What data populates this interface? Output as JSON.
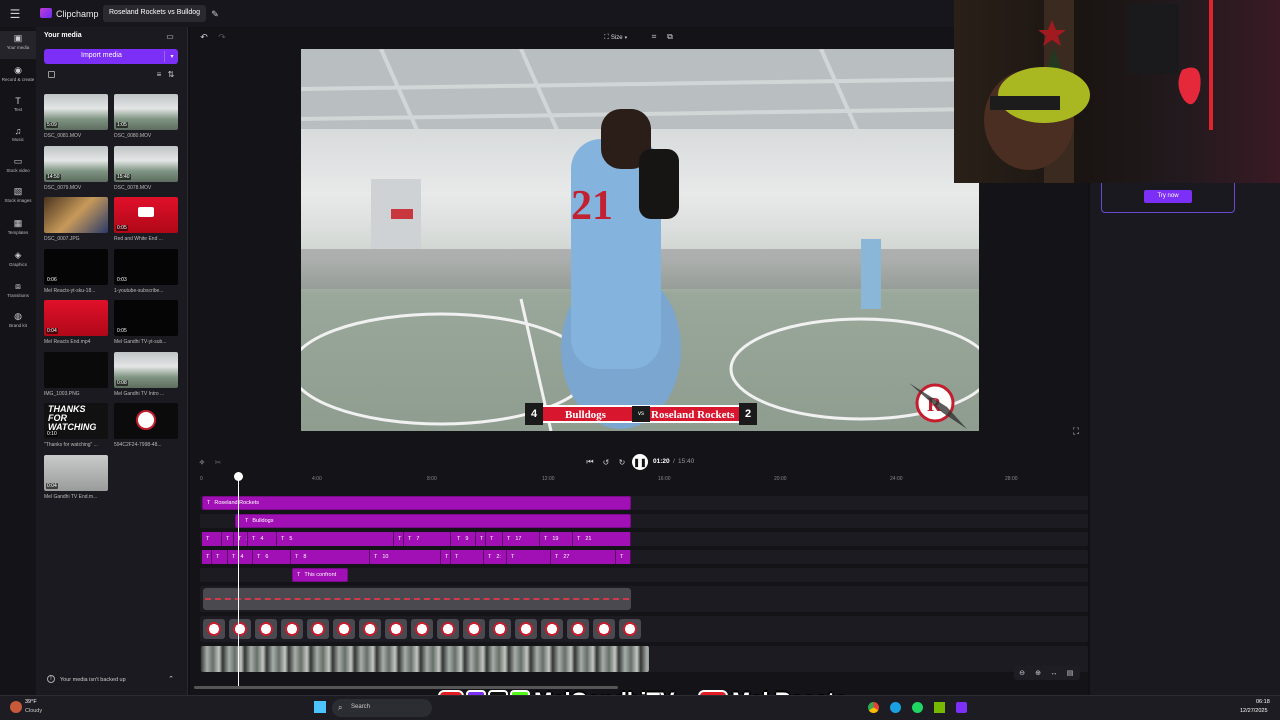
{
  "app": {
    "name": "Clipchamp",
    "project_title": "Roseland Rockets vs Bulldog"
  },
  "rail": [
    {
      "label": "Your media",
      "icon": "folder-icon"
    },
    {
      "label": "Record & create",
      "icon": "camera-icon"
    },
    {
      "label": "Text",
      "icon": "text-icon"
    },
    {
      "label": "Music",
      "icon": "music-icon"
    },
    {
      "label": "Stock video",
      "icon": "film-icon"
    },
    {
      "label": "Stock images",
      "icon": "image-icon"
    },
    {
      "label": "Templates",
      "icon": "template-icon"
    },
    {
      "label": "Graphics",
      "icon": "shapes-icon"
    },
    {
      "label": "Transitions",
      "icon": "transition-icon"
    },
    {
      "label": "Brand kit",
      "icon": "brand-icon"
    }
  ],
  "media": {
    "title": "Your media",
    "import_label": "Import media",
    "backup_notice": "Your media isn't backed up",
    "items": [
      {
        "duration": "5:09",
        "name": "DSC_0081.MOV",
        "kind": "court"
      },
      {
        "duration": "1:05",
        "name": "DSC_0080.MOV",
        "kind": "court"
      },
      {
        "duration": "14:50",
        "name": "DSC_0079.MOV",
        "kind": "court"
      },
      {
        "duration": "15:40",
        "name": "DSC_0078.MOV",
        "kind": "court"
      },
      {
        "duration": "",
        "name": "DSC_0007.JPG",
        "kind": "room"
      },
      {
        "duration": "0:05",
        "name": "Red and White End ...",
        "kind": "red"
      },
      {
        "duration": "0:06",
        "name": "Mel Reacts-yt-sku-18...",
        "kind": "black"
      },
      {
        "duration": "0:03",
        "name": "1-youtube-subscribe...",
        "kind": "black"
      },
      {
        "duration": "0:04",
        "name": "Mel Reacts End.mp4",
        "kind": "red"
      },
      {
        "duration": "0:05",
        "name": "Mel Gandhi TV-yt-sub...",
        "kind": "black"
      },
      {
        "duration": "",
        "name": "IMG_1003.PNG",
        "kind": "dark"
      },
      {
        "duration": "0:08",
        "name": "Mel Gandhi TV Intro ...",
        "kind": "court"
      },
      {
        "duration": "0:10",
        "name": "\"Thanks for watching\" ...",
        "kind": "thanks",
        "overlay": "THANKS FOR WATCHING"
      },
      {
        "duration": "",
        "name": "594C2F24-7998-48...",
        "kind": "logo"
      },
      {
        "duration": "0:04",
        "name": "Mel Gandhi TV End.m...",
        "kind": "gray"
      }
    ]
  },
  "stage": {
    "size_label": "Size",
    "scoreboard": {
      "team_a": "Bulldogs",
      "score_a": "4",
      "vs": "vs",
      "team_b": "Roseland Rockets",
      "score_b": "2"
    }
  },
  "playback": {
    "current": "01:20",
    "total": "15:40",
    "separator": "/"
  },
  "ruler": [
    "0",
    "4:00",
    "8:00",
    "12:00",
    "16:00",
    "20:00",
    "24:00",
    "28:00"
  ],
  "tracks": {
    "text1": "Roseland Rockets",
    "text2": "Bulldogs",
    "row3": [
      "",
      "",
      "3",
      "4",
      "5",
      "",
      "7",
      "",
      "9",
      "",
      "",
      "17",
      "19",
      "21"
    ],
    "row4": [
      "",
      "",
      "4",
      "6",
      "8",
      "10",
      "",
      "",
      "2:",
      "",
      "27",
      ""
    ],
    "text5": "This confront"
  },
  "right": {
    "try_now": "Try now"
  },
  "overlay": {
    "channel1": "MelGandhiTV",
    "channel2": "Mel Reacts"
  },
  "taskbar": {
    "weather_temp": "39°F",
    "weather_desc": "Cloudy",
    "search": "Search",
    "time": "06:18",
    "date": "12/27/2025"
  },
  "colors": {
    "accent": "#7b2ff7",
    "clip": "#a010b4",
    "scoreboard_red": "#d8172f"
  }
}
